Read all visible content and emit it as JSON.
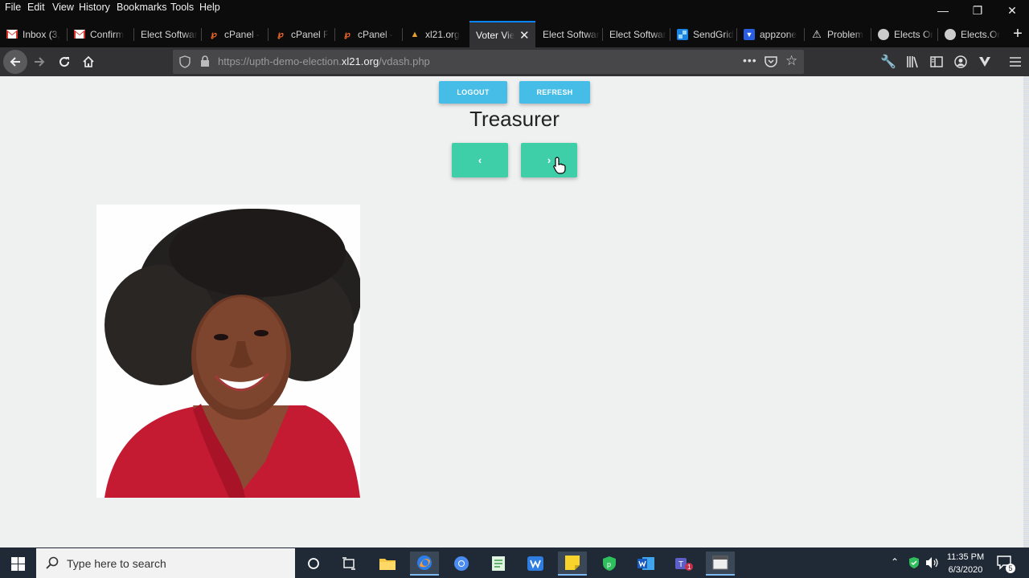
{
  "menu": [
    "File",
    "Edit",
    "View",
    "History",
    "Bookmarks",
    "Tools",
    "Help"
  ],
  "tabs": [
    {
      "label": "Inbox (3,",
      "icon": "gmail-icon"
    },
    {
      "label": "Confirm",
      "icon": "gmail-icon"
    },
    {
      "label": "Elect Softwar",
      "icon": ""
    },
    {
      "label": "cPanel -",
      "icon": "cpanel-icon"
    },
    {
      "label": "cPanel F",
      "icon": "cpanel-icon"
    },
    {
      "label": "cPanel -",
      "icon": "cpanel-icon"
    },
    {
      "label": "xl21.org",
      "icon": "xl21-icon"
    },
    {
      "label": "Voter Vie",
      "icon": ""
    },
    {
      "label": "Elect Softwar",
      "icon": ""
    },
    {
      "label": "Elect Softwar",
      "icon": ""
    },
    {
      "label": "SendGrid",
      "icon": "sendgrid-icon"
    },
    {
      "label": "appzone",
      "icon": "shield-icon"
    },
    {
      "label": "Problem",
      "icon": "warning-icon"
    },
    {
      "label": "Elects Or",
      "icon": "globe-icon"
    },
    {
      "label": "Elects.Or",
      "icon": "globe-icon"
    }
  ],
  "url": {
    "prefix": "https://upth-demo-election.",
    "domain": "xl21.org",
    "path": "/vdash.php"
  },
  "page": {
    "logout": "LOGOUT",
    "refresh": "REFRESH",
    "title": "Treasurer",
    "prev": "‹",
    "next": "›"
  },
  "taskbar": {
    "search_placeholder": "Type here to search",
    "time": "11:35 PM",
    "date": "6/3/2020",
    "notifications": "5"
  },
  "colors": {
    "accent_blue": "#45bde6",
    "accent_teal": "#3ecfa9",
    "tab_highlight": "#0a84ff"
  }
}
